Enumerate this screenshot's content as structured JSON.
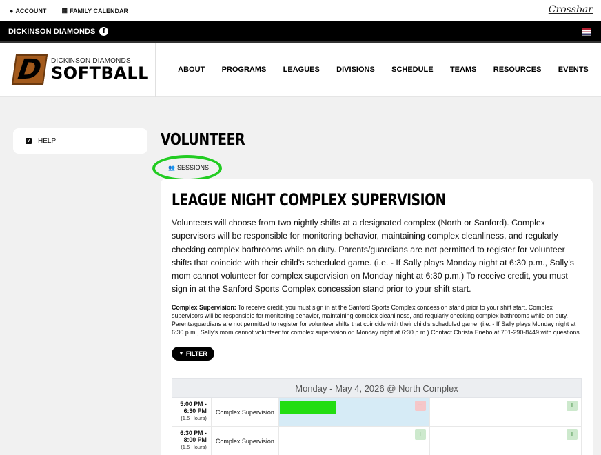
{
  "utility": {
    "account": "ACCOUNT",
    "family_calendar": "FAMILY CALENDAR",
    "crossbar": "Crossbar"
  },
  "org": {
    "name": "DICKINSON DIAMONDS",
    "facebook_glyph": "f"
  },
  "logo": {
    "letter": "D",
    "top": "DICKINSON DIAMONDS",
    "bottom": "SOFTBALL"
  },
  "nav": [
    "ABOUT",
    "PROGRAMS",
    "LEAGUES",
    "DIVISIONS",
    "SCHEDULE",
    "TEAMS",
    "RESOURCES",
    "EVENTS"
  ],
  "sidebar": {
    "help_icon": "?",
    "help_label": "HELP"
  },
  "page": {
    "title": "VOLUNTEER",
    "sessions_tab": "SESSIONS"
  },
  "card": {
    "title": "LEAGUE NIGHT COMPLEX SUPERVISION",
    "description": "Volunteers will choose from two nightly shifts at a designated complex (North or Sanford). Complex supervisors will be responsible for monitoring behavior, maintaining complex cleanliness, and regularly checking complex bathrooms while on duty. Parents/guardians are not permitted to register for volunteer shifts that coincide with their child's scheduled game. (i.e. - If Sally plays Monday night at 6:30 p.m., Sally's mom cannot volunteer for complex supervision on Monday night at 6:30 p.m.) To receive credit, you must sign in at the Sanford Sports Complex concession stand prior to your shift start.",
    "note_label": "Complex Supervision:",
    "note_text": " To receive credit, you must sign in at the Sanford Sports Complex concession stand prior to your shift start. Complex supervisors will be responsible for monitoring behavior, maintaining complex cleanliness, and regularly checking complex bathrooms while on duty. Parents/guardians are not permitted to register for volunteer shifts that coincide with their child's scheduled game. (i.e. - If Sally plays Monday night at 6:30 p.m., Sally's mom cannot volunteer for complex supervision on Monday night at 6:30 p.m.) Contact Christa Enebo at 701-290-8449 with questions.",
    "filter_label": "FILTER"
  },
  "schedule": {
    "header": "Monday - May 4, 2026 @ North Complex",
    "rows": [
      {
        "time": "5:00 PM - 6:30 PM",
        "time_a": "5:00 PM -",
        "time_b": "6:30 PM",
        "duration": "(1.5 Hours)",
        "role": "Complex Supervision"
      },
      {
        "time": "6:30 PM - 8:00 PM",
        "time_a": "6:30 PM -",
        "time_b": "8:00 PM",
        "duration": "(1.5 Hours)",
        "role": "Complex Supervision"
      }
    ],
    "minus_glyph": "−",
    "plus_glyph": "+"
  },
  "colors": {
    "highlight_circle": "#22cc22",
    "filled_slot_bar": "#22dd11",
    "filled_slot_bg": "#d6ebf6",
    "brand_orange": "#a35a1c"
  }
}
